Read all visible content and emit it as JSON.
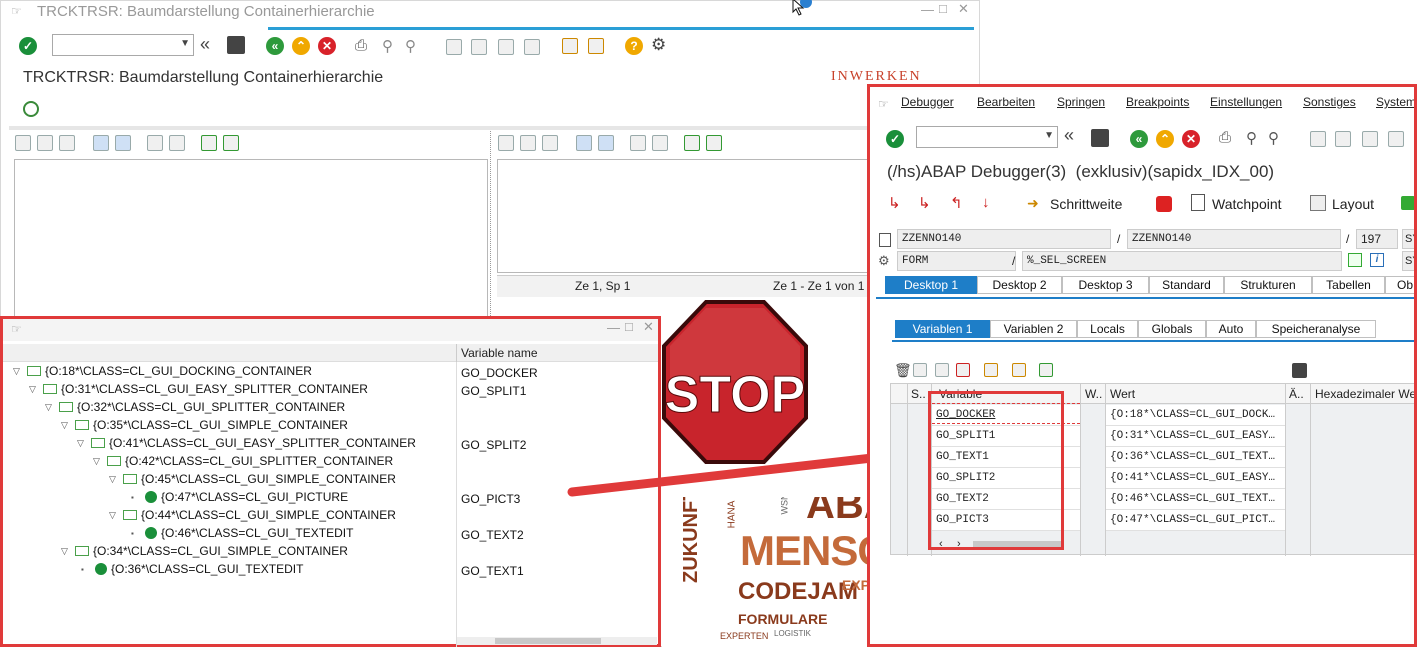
{
  "bg_window": {
    "title": "TRCKTRSR: Baumdarstellung Containerhierarchie",
    "heading": "TRCKTRSR: Baumdarstellung Containerhierarchie",
    "logo": "INWERKEN",
    "status_left": "Ze 1, Sp 1",
    "status_right": "Ze 1 - Ze 1 von 1"
  },
  "tree_panel": {
    "column_header": "Variable name",
    "rows": [
      {
        "label": "{O:18*\\CLASS=CL_GUI_DOCKING_CONTAINER",
        "var": "GO_DOCKER"
      },
      {
        "label": "{O:31*\\CLASS=CL_GUI_EASY_SPLITTER_CONTAINER",
        "var": "GO_SPLIT1"
      },
      {
        "label": "{O:32*\\CLASS=CL_GUI_SPLITTER_CONTAINER",
        "var": ""
      },
      {
        "label": "{O:35*\\CLASS=CL_GUI_SIMPLE_CONTAINER",
        "var": ""
      },
      {
        "label": "{O:41*\\CLASS=CL_GUI_EASY_SPLITTER_CONTAINER",
        "var": "GO_SPLIT2"
      },
      {
        "label": "{O:42*\\CLASS=CL_GUI_SPLITTER_CONTAINER",
        "var": ""
      },
      {
        "label": "{O:45*\\CLASS=CL_GUI_SIMPLE_CONTAINER",
        "var": ""
      },
      {
        "label": "{O:47*\\CLASS=CL_GUI_PICTURE",
        "var": "GO_PICT3"
      },
      {
        "label": "{O:44*\\CLASS=CL_GUI_SIMPLE_CONTAINER",
        "var": ""
      },
      {
        "label": "{O:46*\\CLASS=CL_GUI_TEXTEDIT",
        "var": "GO_TEXT2"
      },
      {
        "label": "{O:34*\\CLASS=CL_GUI_SIMPLE_CONTAINER",
        "var": ""
      },
      {
        "label": "{O:36*\\CLASS=CL_GUI_TEXTEDIT",
        "var": "GO_TEXT1"
      }
    ]
  },
  "stop_sign": {
    "text": "STOP"
  },
  "word_cloud": {
    "words": [
      "MENSCH",
      "CODEJAM",
      "ZUKUNFT",
      "FORMULARE",
      "EXPERTEN",
      "SERV",
      "ABAP",
      "WSN",
      "HANA",
      "LOGISTIK"
    ]
  },
  "debugger": {
    "menu": [
      "Debugger",
      "Bearbeiten",
      "Springen",
      "Breakpoints",
      "Einstellungen",
      "Sonstiges",
      "System"
    ],
    "title": "(/hs)ABAP Debugger(3)  (exklusiv)(sapidx_IDX_00)",
    "actions": {
      "step": "Schrittweite",
      "watchpoint": "Watchpoint",
      "layout": "Layout"
    },
    "fields": {
      "prog1": "ZZENNO140",
      "prog2": "ZZENNO140",
      "line": "197",
      "sy1": "SY",
      "type": "FORM",
      "name": "%_SEL_SCREEN",
      "sy2": "SY",
      "slash": "/"
    },
    "desktop_tabs": [
      "Desktop 1",
      "Desktop 2",
      "Desktop 3",
      "Standard",
      "Strukturen",
      "Tabellen",
      "Ob"
    ],
    "var_tabs": [
      "Variablen 1",
      "Variablen 2",
      "Locals",
      "Globals",
      "Auto",
      "Speicheranalyse"
    ],
    "table": {
      "headers": {
        "s": "S..",
        "variable": "Variable",
        "w": "W..",
        "wert": "Wert",
        "a": "Ä..",
        "hex": "Hexadezimaler We"
      },
      "rows": [
        {
          "variable": "GO_DOCKER",
          "wert": "{O:18*\\CLASS=CL_GUI_DOCK…"
        },
        {
          "variable": "GO_SPLIT1",
          "wert": "{O:31*\\CLASS=CL_GUI_EASY…"
        },
        {
          "variable": "GO_TEXT1",
          "wert": "{O:36*\\CLASS=CL_GUI_TEXT…"
        },
        {
          "variable": "GO_SPLIT2",
          "wert": "{O:41*\\CLASS=CL_GUI_EASY…"
        },
        {
          "variable": "GO_TEXT2",
          "wert": "{O:46*\\CLASS=CL_GUI_TEXT…"
        },
        {
          "variable": "GO_PICT3",
          "wert": "{O:47*\\CLASS=CL_GUI_PICT…"
        }
      ]
    }
  },
  "colors": {
    "accent": "#1e7ec8",
    "highlight": "#e03a3a",
    "green": "#1a8f3a"
  }
}
